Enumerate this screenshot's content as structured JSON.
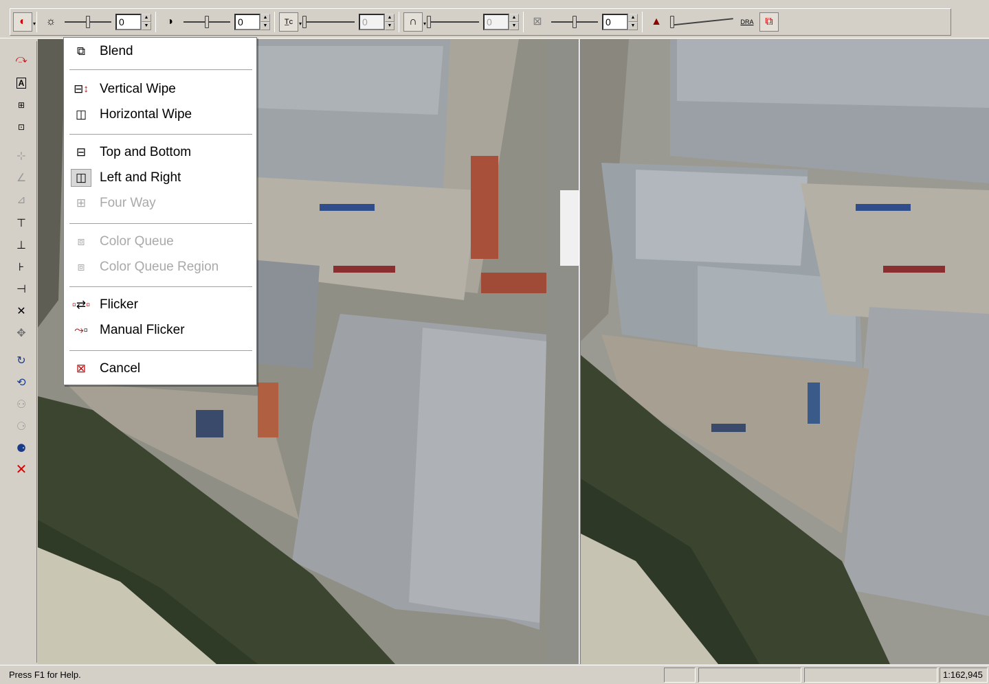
{
  "toolbar": {
    "brightness_value": "0",
    "contrast_value": "0",
    "tone_value": "0",
    "curve_value": "0",
    "sharpen_value": "0",
    "dra_label": "DRA"
  },
  "menu": {
    "items": [
      {
        "label": "Blend",
        "icon": "blend-icon",
        "enabled": true
      },
      {
        "label": "Vertical Wipe",
        "icon": "vertical-wipe-icon",
        "enabled": true
      },
      {
        "label": "Horizontal Wipe",
        "icon": "horizontal-wipe-icon",
        "enabled": true
      },
      {
        "label": "Top and Bottom",
        "icon": "top-bottom-icon",
        "enabled": true
      },
      {
        "label": "Left and Right",
        "icon": "left-right-icon",
        "enabled": true
      },
      {
        "label": "Four Way",
        "icon": "four-way-icon",
        "enabled": false
      },
      {
        "label": "Color Queue",
        "icon": "color-queue-icon",
        "enabled": false
      },
      {
        "label": "Color Queue Region",
        "icon": "color-queue-region-icon",
        "enabled": false
      },
      {
        "label": "Flicker",
        "icon": "flicker-icon",
        "enabled": true
      },
      {
        "label": "Manual Flicker",
        "icon": "manual-flicker-icon",
        "enabled": true
      },
      {
        "label": "Cancel",
        "icon": "cancel-icon",
        "enabled": true
      }
    ]
  },
  "statusbar": {
    "help_text": "Press F1 for Help.",
    "scale": "1:162,945"
  }
}
